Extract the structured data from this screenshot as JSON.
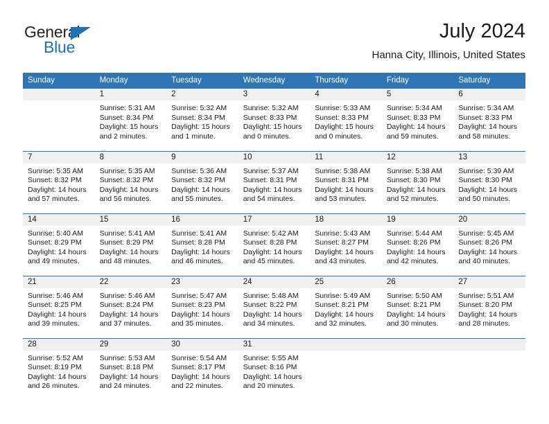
{
  "brand": {
    "word_one": "General",
    "word_two": "Blue",
    "triangle_icon": "triangle-logo-icon",
    "color_primary": "#1a72b8",
    "color_text": "#231f20"
  },
  "header": {
    "title": "July 2024",
    "subtitle": "Hanna City, Illinois, United States"
  },
  "theme": {
    "header_band": "#2e75b6",
    "daynum_band": "#f0f0f0",
    "row_rule": "#2e75b6",
    "text": "#1a1a1a"
  },
  "calendar": {
    "weekday_headers": [
      "Sunday",
      "Monday",
      "Tuesday",
      "Wednesday",
      "Thursday",
      "Friday",
      "Saturday"
    ],
    "weeks": [
      [
        {
          "day": "",
          "empty": true
        },
        {
          "day": "1",
          "sunrise": "Sunrise: 5:31 AM",
          "sunset": "Sunset: 8:34 PM",
          "daylight_1": "Daylight: 15 hours",
          "daylight_2": "and 2 minutes."
        },
        {
          "day": "2",
          "sunrise": "Sunrise: 5:32 AM",
          "sunset": "Sunset: 8:34 PM",
          "daylight_1": "Daylight: 15 hours",
          "daylight_2": "and 1 minute."
        },
        {
          "day": "3",
          "sunrise": "Sunrise: 5:32 AM",
          "sunset": "Sunset: 8:33 PM",
          "daylight_1": "Daylight: 15 hours",
          "daylight_2": "and 0 minutes."
        },
        {
          "day": "4",
          "sunrise": "Sunrise: 5:33 AM",
          "sunset": "Sunset: 8:33 PM",
          "daylight_1": "Daylight: 15 hours",
          "daylight_2": "and 0 minutes."
        },
        {
          "day": "5",
          "sunrise": "Sunrise: 5:34 AM",
          "sunset": "Sunset: 8:33 PM",
          "daylight_1": "Daylight: 14 hours",
          "daylight_2": "and 59 minutes."
        },
        {
          "day": "6",
          "sunrise": "Sunrise: 5:34 AM",
          "sunset": "Sunset: 8:33 PM",
          "daylight_1": "Daylight: 14 hours",
          "daylight_2": "and 58 minutes."
        }
      ],
      [
        {
          "day": "7",
          "sunrise": "Sunrise: 5:35 AM",
          "sunset": "Sunset: 8:32 PM",
          "daylight_1": "Daylight: 14 hours",
          "daylight_2": "and 57 minutes."
        },
        {
          "day": "8",
          "sunrise": "Sunrise: 5:35 AM",
          "sunset": "Sunset: 8:32 PM",
          "daylight_1": "Daylight: 14 hours",
          "daylight_2": "and 56 minutes."
        },
        {
          "day": "9",
          "sunrise": "Sunrise: 5:36 AM",
          "sunset": "Sunset: 8:32 PM",
          "daylight_1": "Daylight: 14 hours",
          "daylight_2": "and 55 minutes."
        },
        {
          "day": "10",
          "sunrise": "Sunrise: 5:37 AM",
          "sunset": "Sunset: 8:31 PM",
          "daylight_1": "Daylight: 14 hours",
          "daylight_2": "and 54 minutes."
        },
        {
          "day": "11",
          "sunrise": "Sunrise: 5:38 AM",
          "sunset": "Sunset: 8:31 PM",
          "daylight_1": "Daylight: 14 hours",
          "daylight_2": "and 53 minutes."
        },
        {
          "day": "12",
          "sunrise": "Sunrise: 5:38 AM",
          "sunset": "Sunset: 8:30 PM",
          "daylight_1": "Daylight: 14 hours",
          "daylight_2": "and 52 minutes."
        },
        {
          "day": "13",
          "sunrise": "Sunrise: 5:39 AM",
          "sunset": "Sunset: 8:30 PM",
          "daylight_1": "Daylight: 14 hours",
          "daylight_2": "and 50 minutes."
        }
      ],
      [
        {
          "day": "14",
          "sunrise": "Sunrise: 5:40 AM",
          "sunset": "Sunset: 8:29 PM",
          "daylight_1": "Daylight: 14 hours",
          "daylight_2": "and 49 minutes."
        },
        {
          "day": "15",
          "sunrise": "Sunrise: 5:41 AM",
          "sunset": "Sunset: 8:29 PM",
          "daylight_1": "Daylight: 14 hours",
          "daylight_2": "and 48 minutes."
        },
        {
          "day": "16",
          "sunrise": "Sunrise: 5:41 AM",
          "sunset": "Sunset: 8:28 PM",
          "daylight_1": "Daylight: 14 hours",
          "daylight_2": "and 46 minutes."
        },
        {
          "day": "17",
          "sunrise": "Sunrise: 5:42 AM",
          "sunset": "Sunset: 8:28 PM",
          "daylight_1": "Daylight: 14 hours",
          "daylight_2": "and 45 minutes."
        },
        {
          "day": "18",
          "sunrise": "Sunrise: 5:43 AM",
          "sunset": "Sunset: 8:27 PM",
          "daylight_1": "Daylight: 14 hours",
          "daylight_2": "and 43 minutes."
        },
        {
          "day": "19",
          "sunrise": "Sunrise: 5:44 AM",
          "sunset": "Sunset: 8:26 PM",
          "daylight_1": "Daylight: 14 hours",
          "daylight_2": "and 42 minutes."
        },
        {
          "day": "20",
          "sunrise": "Sunrise: 5:45 AM",
          "sunset": "Sunset: 8:26 PM",
          "daylight_1": "Daylight: 14 hours",
          "daylight_2": "and 40 minutes."
        }
      ],
      [
        {
          "day": "21",
          "sunrise": "Sunrise: 5:46 AM",
          "sunset": "Sunset: 8:25 PM",
          "daylight_1": "Daylight: 14 hours",
          "daylight_2": "and 39 minutes."
        },
        {
          "day": "22",
          "sunrise": "Sunrise: 5:46 AM",
          "sunset": "Sunset: 8:24 PM",
          "daylight_1": "Daylight: 14 hours",
          "daylight_2": "and 37 minutes."
        },
        {
          "day": "23",
          "sunrise": "Sunrise: 5:47 AM",
          "sunset": "Sunset: 8:23 PM",
          "daylight_1": "Daylight: 14 hours",
          "daylight_2": "and 35 minutes."
        },
        {
          "day": "24",
          "sunrise": "Sunrise: 5:48 AM",
          "sunset": "Sunset: 8:22 PM",
          "daylight_1": "Daylight: 14 hours",
          "daylight_2": "and 34 minutes."
        },
        {
          "day": "25",
          "sunrise": "Sunrise: 5:49 AM",
          "sunset": "Sunset: 8:21 PM",
          "daylight_1": "Daylight: 14 hours",
          "daylight_2": "and 32 minutes."
        },
        {
          "day": "26",
          "sunrise": "Sunrise: 5:50 AM",
          "sunset": "Sunset: 8:21 PM",
          "daylight_1": "Daylight: 14 hours",
          "daylight_2": "and 30 minutes."
        },
        {
          "day": "27",
          "sunrise": "Sunrise: 5:51 AM",
          "sunset": "Sunset: 8:20 PM",
          "daylight_1": "Daylight: 14 hours",
          "daylight_2": "and 28 minutes."
        }
      ],
      [
        {
          "day": "28",
          "sunrise": "Sunrise: 5:52 AM",
          "sunset": "Sunset: 8:19 PM",
          "daylight_1": "Daylight: 14 hours",
          "daylight_2": "and 26 minutes."
        },
        {
          "day": "29",
          "sunrise": "Sunrise: 5:53 AM",
          "sunset": "Sunset: 8:18 PM",
          "daylight_1": "Daylight: 14 hours",
          "daylight_2": "and 24 minutes."
        },
        {
          "day": "30",
          "sunrise": "Sunrise: 5:54 AM",
          "sunset": "Sunset: 8:17 PM",
          "daylight_1": "Daylight: 14 hours",
          "daylight_2": "and 22 minutes."
        },
        {
          "day": "31",
          "sunrise": "Sunrise: 5:55 AM",
          "sunset": "Sunset: 8:16 PM",
          "daylight_1": "Daylight: 14 hours",
          "daylight_2": "and 20 minutes."
        },
        {
          "day": "",
          "empty": true
        },
        {
          "day": "",
          "empty": true
        },
        {
          "day": "",
          "empty": true
        }
      ]
    ]
  }
}
